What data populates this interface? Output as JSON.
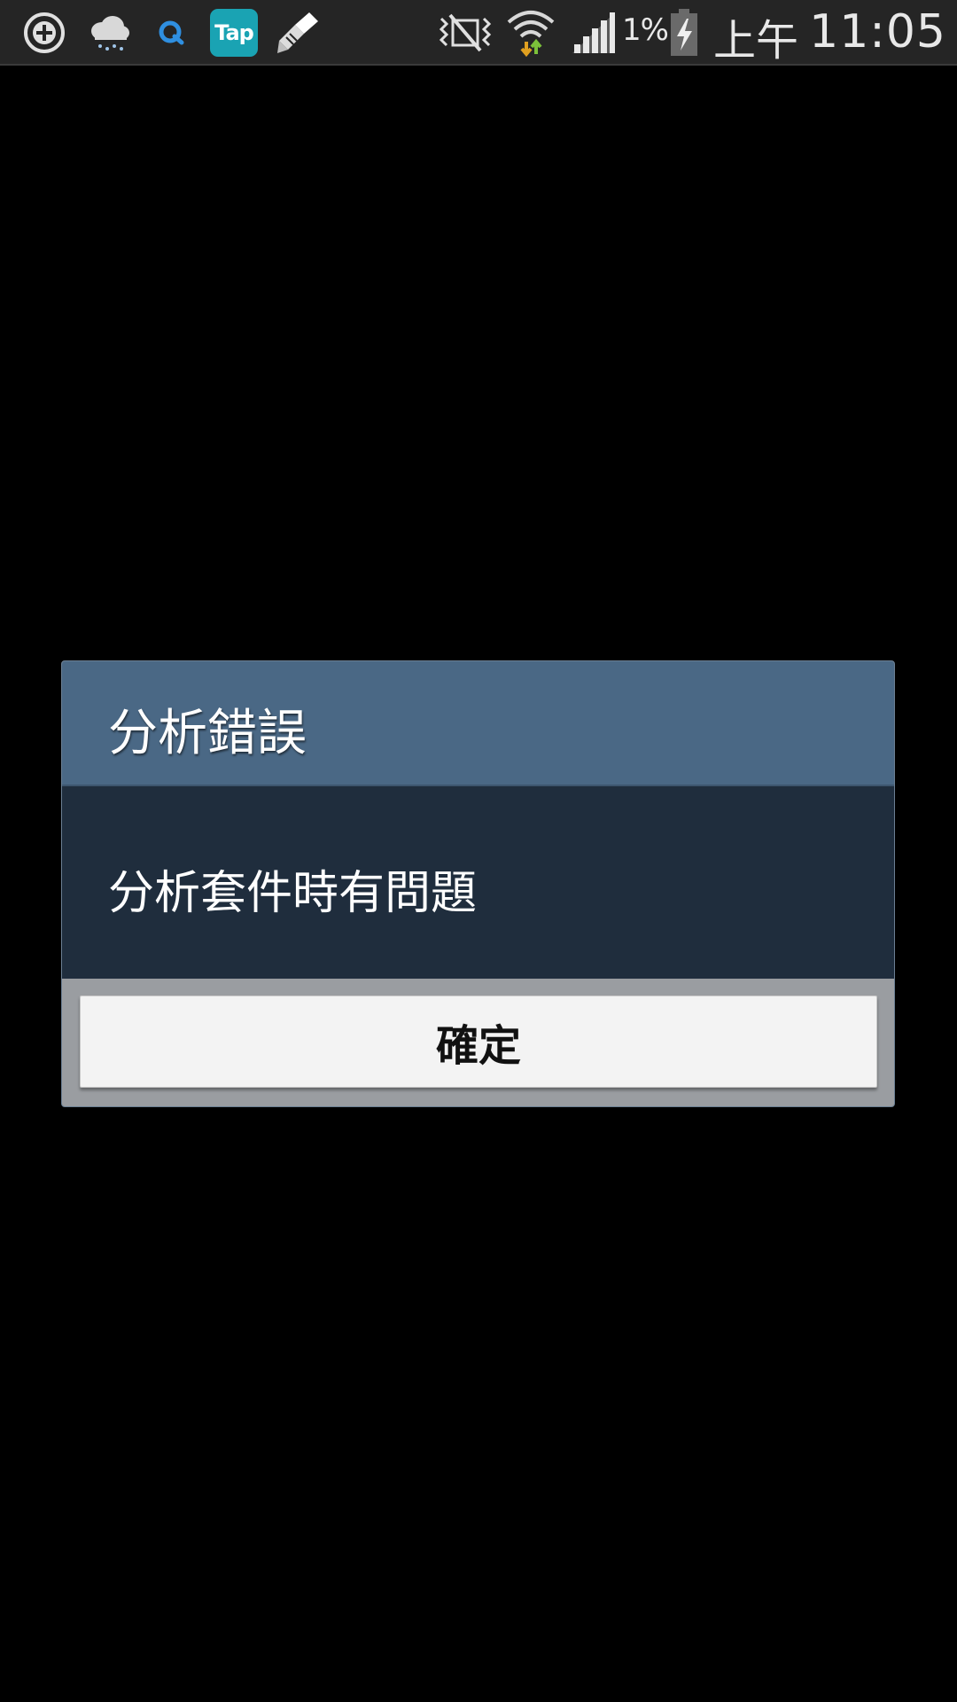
{
  "status_bar": {
    "battery_percent": "1%",
    "ampm": "上午",
    "time": "11:05",
    "notification_icons": [
      "add-circle-icon",
      "cloud-rain-icon",
      "q-browser-icon",
      "tap-app-icon",
      "brush-icon"
    ],
    "tap_badge_label": "Tap",
    "system_icons": [
      "mute-icon",
      "wifi-icon",
      "signal-icon",
      "battery-charging-icon"
    ],
    "colors": {
      "background": "#252525",
      "text": "#e8e8e8",
      "tap_badge": "#1aa3b3",
      "wifi_down_arrow": "#e0a020",
      "wifi_up_arrow": "#7cc13a"
    }
  },
  "dialog": {
    "title": "分析錯誤",
    "message": "分析套件時有問題",
    "ok_label": "確定",
    "colors": {
      "title_bar": "#4a6885",
      "body": "#1f2d3d",
      "button_area": "#9a9da1",
      "button": "#f3f3f3"
    }
  }
}
